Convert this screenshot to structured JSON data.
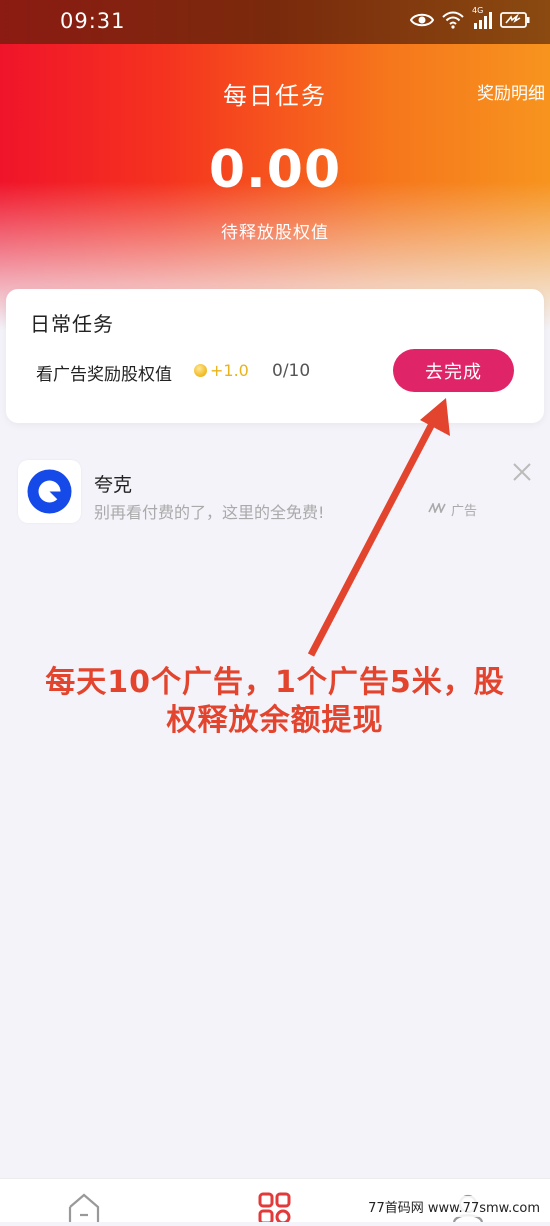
{
  "status_bar": {
    "time": "09:31",
    "network": "4G",
    "icons": [
      "eye-icon",
      "wifi-icon",
      "signal-icon",
      "battery-charging-icon"
    ]
  },
  "header": {
    "title": "每日任务",
    "reward_detail_link": "奖励明细",
    "value": "0.00",
    "value_caption": "待释放股权值"
  },
  "task_card": {
    "title": "日常任务",
    "tasks": [
      {
        "name": "看广告奖励股权值",
        "reward": "+1.0",
        "progress": "0/10",
        "button_label": "去完成"
      }
    ]
  },
  "ad": {
    "title": "夸克",
    "subtitle": "别再看付费的了，这里的全免费!",
    "ad_label": "广告"
  },
  "annotation": {
    "line1": "每天10个广告，1个广告5米，股",
    "line2": "权释放余额提现"
  },
  "bottom_tabs": [
    {
      "icon": "home-icon"
    },
    {
      "icon": "tasks-grid-icon",
      "active": true
    },
    {
      "icon": "profile-icon"
    }
  ],
  "watermark": "77首码网 www.77smw.com",
  "colors": {
    "header_gradient_start": "#f0142a",
    "header_gradient_end": "#f7941e",
    "button": "#df2467",
    "coin_reward": "#e9b31c",
    "annotation": "#e2442e",
    "active_tab": "#e23a3a"
  }
}
